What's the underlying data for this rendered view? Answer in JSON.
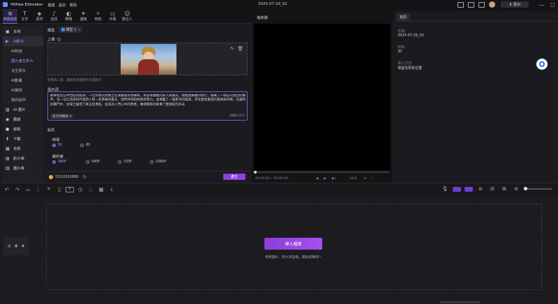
{
  "app": {
    "name": "HitPaw Edimakor",
    "menu": [
      "檔案",
      "設定",
      "幫助"
    ],
    "project_name": "2025-07-29_02",
    "export_label": "匯出"
  },
  "toolbar": [
    {
      "icon": "media-icon",
      "glyph": "⧉",
      "label": "媒體檔案",
      "active": true
    },
    {
      "icon": "text-icon",
      "glyph": "T",
      "label": "文字"
    },
    {
      "icon": "material-icon",
      "glyph": "◈",
      "label": "素材"
    },
    {
      "icon": "audio-icon",
      "glyph": "♪",
      "label": "音訊"
    },
    {
      "icon": "filter-icon",
      "glyph": "◐",
      "label": "轉場"
    },
    {
      "icon": "effect-icon",
      "glyph": "✶",
      "label": "濾鏡"
    },
    {
      "icon": "sticker-icon",
      "glyph": "✧",
      "label": "特效"
    },
    {
      "icon": "subtitle-icon",
      "glyph": "▭",
      "label": "字幕"
    },
    {
      "icon": "avatar-icon",
      "glyph": "☺",
      "label": "數位人"
    }
  ],
  "sidebar": [
    {
      "label": "本地",
      "icon": "folder-icon",
      "glyph": "▣",
      "type": "main"
    },
    {
      "label": "AI影片",
      "icon": "ai-video-icon",
      "glyph": "▶",
      "type": "main",
      "highlight": true
    },
    {
      "label": "AI特效",
      "type": "sub"
    },
    {
      "label": "圖片產生影片",
      "type": "sub",
      "selected": true
    },
    {
      "label": "文生影片",
      "type": "sub"
    },
    {
      "label": "AI動畫",
      "type": "sub"
    },
    {
      "label": "AI擁抱",
      "type": "sub"
    },
    {
      "label": "我的創作",
      "type": "sub"
    },
    {
      "label": "AI 圖片",
      "icon": "ai-image-icon",
      "glyph": "▧",
      "type": "main"
    },
    {
      "label": "圖錄",
      "icon": "record-icon",
      "glyph": "◉",
      "type": "main"
    },
    {
      "label": "錄製",
      "icon": "camera-icon",
      "glyph": "●",
      "type": "main"
    },
    {
      "label": "下載",
      "icon": "download-icon",
      "glyph": "⬇",
      "type": "main"
    },
    {
      "label": "背景",
      "icon": "background-icon",
      "glyph": "▦",
      "type": "main"
    },
    {
      "label": "影片庫",
      "icon": "video-library-icon",
      "glyph": "▤",
      "type": "main"
    },
    {
      "label": "圖片庫",
      "icon": "image-library-icon",
      "glyph": "▥",
      "type": "main"
    }
  ],
  "panel": {
    "model_label": "模型",
    "model_value": "模型 1",
    "upload_label": "上傳",
    "upload_hint": "影像為人臉、鏡頭效果最佳的位置照片",
    "prompt_label": "提示詞",
    "prompt_text": "故事發生在中世紀的歐洲，一位年輕的女騎士在城鎮受到攻擊後，承諾保護她的家人與朋友。她經歷艱難的修行，組織了一群志同道合的夥伴。在一位已流浪的吟遊詩人和一名勇敢的農夫，他們共同對抗邪惡勢力。並揭露了一個更深的陰謀，涉及當地貴族的腐敗與背叛。在最終的戰鬥中，女騎士展現了真正的勇氣，並成為人們心中的勇者，傳頌開來的故事了整個紀元的未",
    "prompt_template": "提示詞模板",
    "prompt_count": "328",
    "prompt_max": "/2000",
    "settings_label": "設定",
    "duration_label": "時長",
    "durations": [
      "5S",
      "8S"
    ],
    "resolution_label": "解析度",
    "resolutions": [
      "360P",
      "540P",
      "720P",
      "1080P"
    ],
    "credits": "155/2261880",
    "generate_label": "產生"
  },
  "player": {
    "title": "播放器",
    "time_current": "00:00:00",
    "time_total": "00:00:00",
    "ratio": "16:9"
  },
  "props": {
    "tab": "資訊",
    "name_label": "名稱:",
    "name_value": "2025-07-29_02",
    "fps_label": "幀率:",
    "fps_value": "30",
    "import_label": "導入方式:",
    "import_value": "保留在原有位置"
  },
  "timeline": {
    "import_button": "導入檔案",
    "hint": "拖曳圖片、影片到這裡，開始剪輯吧~"
  },
  "colors": {
    "accent": "#8e3fe0",
    "background": "#1b1b1f"
  }
}
